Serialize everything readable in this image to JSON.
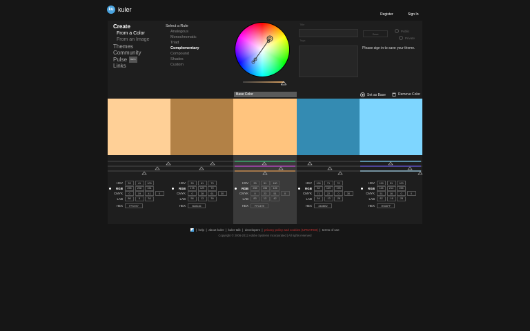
{
  "header": {
    "logo_badge": "ku",
    "logo_text": "kuler",
    "register": "Register",
    "signin": "Sign In"
  },
  "nav": {
    "create": "Create",
    "from_color": "From a Color",
    "from_image": "From an Image",
    "themes": "Themes",
    "community": "Community",
    "pulse": "Pulse",
    "pulse_badge": "BETA",
    "links": "Links"
  },
  "rules": {
    "title": "Select a Rule",
    "items": [
      "Analogous",
      "Monochromatic",
      "Triad",
      "Complementary",
      "Compound",
      "Shades",
      "Custom"
    ],
    "active": "Complementary"
  },
  "form": {
    "title_label": "Title",
    "tags_label": "Tags",
    "save": "Save",
    "public": "Public",
    "private": "Private",
    "signin_msg": "Please sign in to save your theme."
  },
  "toolbar": {
    "base_color": "Base Color",
    "set_as_base": "Set as Base",
    "remove_color": "Remove Color"
  },
  "colors": [
    {
      "hex": "FFD097",
      "color": "#FFD097",
      "hsv": [
        "33",
        "41",
        "100"
      ],
      "rgb": [
        "255",
        "208",
        "151"
      ],
      "cmyk": [
        "0",
        "19",
        "41",
        "0"
      ],
      "lab": [
        "86",
        "9",
        "34"
      ]
    },
    {
      "hex": "B28146",
      "color": "#B28146",
      "hsv": [
        "33",
        "61",
        "70"
      ],
      "rgb": [
        "178",
        "129",
        "70"
      ],
      "cmyk": [
        "0",
        "28",
        "61",
        "30"
      ],
      "lab": [
        "58",
        "13",
        "39"
      ]
    },
    {
      "hex": "FFC47E",
      "color": "#FFC47E",
      "hsv": [
        "33",
        "51",
        "100"
      ],
      "rgb": [
        "255",
        "196",
        "126"
      ],
      "cmyk": [
        "0",
        "23",
        "51",
        "0"
      ],
      "lab": [
        "83",
        "13",
        "42"
      ]
    },
    {
      "hex": "348BB2",
      "color": "#348BB2",
      "hsv": [
        "199",
        "71",
        "70"
      ],
      "rgb": [
        "52",
        "139",
        "178"
      ],
      "cmyk": [
        "71",
        "22",
        "0",
        "30"
      ],
      "lab": [
        "54",
        "-13",
        "-28"
      ]
    },
    {
      "hex": "7ED6FF",
      "color": "#7ED6FF",
      "hsv": [
        "199",
        "51",
        "100"
      ],
      "rgb": [
        "126",
        "214",
        "255"
      ],
      "cmyk": [
        "51",
        "16",
        "0",
        "0"
      ],
      "lab": [
        "82",
        "-16",
        "-28"
      ]
    }
  ],
  "value_labels": {
    "hsv": "HSV",
    "rgb": "RGB",
    "cmyk": "CMYK",
    "lab": "LAB",
    "hex": "HEX"
  },
  "footer": {
    "links": [
      "help",
      "about kuler",
      "kuler talk",
      "developers",
      "privacy policy and cookies (UPDATED)",
      "terms of use"
    ],
    "copyright": "Copyright © 2006-2012 Adobe Systems Incorporated | All rights reserved"
  }
}
